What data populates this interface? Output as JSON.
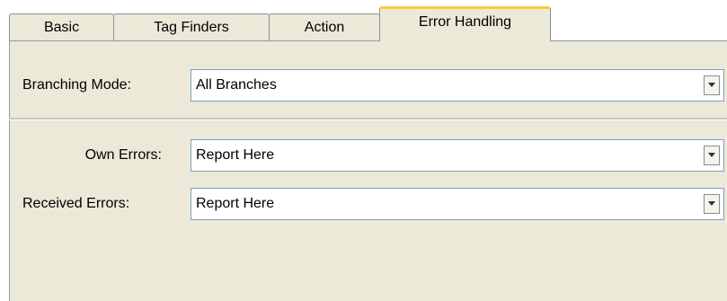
{
  "tabs": {
    "basic": "Basic",
    "tag_finders": "Tag Finders",
    "action": "Action",
    "error_handling": "Error Handling",
    "active": "error_handling"
  },
  "form": {
    "branching_mode": {
      "label": "Branching Mode:",
      "value": "All Branches"
    },
    "own_errors": {
      "label": "Own Errors:",
      "value": "Report Here"
    },
    "received_errors": {
      "label": "Received Errors:",
      "value": "Report Here"
    }
  },
  "icons": {
    "dropdown": "chevron-down-icon"
  },
  "colors": {
    "panel_bg": "#ece9d8",
    "active_tab_accent": "#ffc83c",
    "field_border": "#7f9db9"
  }
}
